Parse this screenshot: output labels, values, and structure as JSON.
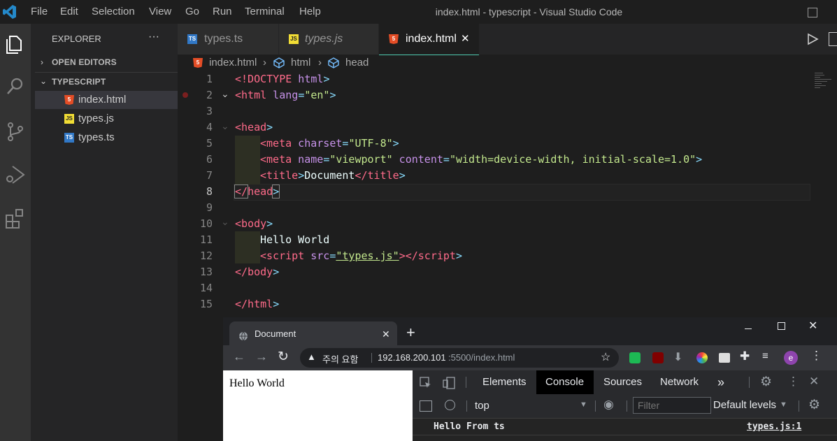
{
  "window": {
    "title": "index.html - typescript - Visual Studio Code"
  },
  "menu": [
    "File",
    "Edit",
    "Selection",
    "View",
    "Go",
    "Run",
    "Terminal",
    "Help"
  ],
  "sidebar": {
    "title": "EXPLORER",
    "more": "···",
    "open_editors": "OPEN EDITORS",
    "folder": "TYPESCRIPT",
    "files": [
      {
        "name": "index.html",
        "icon": "html-file-icon"
      },
      {
        "name": "types.js",
        "icon": "js-file-icon"
      },
      {
        "name": "types.ts",
        "icon": "ts-file-icon"
      }
    ]
  },
  "tabs": [
    {
      "label": "types.ts"
    },
    {
      "label": "types.js"
    },
    {
      "label": "index.html",
      "close": "✕"
    }
  ],
  "breadcrumb": [
    "index.html",
    "html",
    "head"
  ],
  "editor": {
    "line_numbers": [
      "1",
      "2",
      "3",
      "4",
      "5",
      "6",
      "7",
      "8",
      "9",
      "10",
      "11",
      "12",
      "13",
      "14",
      "15"
    ],
    "lines": {
      "l1a": "<!DOCTYPE",
      "l1b": " html",
      "l1c": ">",
      "l2a": "<html",
      "l2b": " lang",
      "l2c": "=",
      "l2d": "\"en\"",
      "l2e": ">",
      "l4a": "<head",
      "l4b": ">",
      "l5a": "<meta",
      "l5b": " charset",
      "l5c": "=",
      "l5d": "\"UTF-8\"",
      "l5e": ">",
      "l6a": "<meta",
      "l6b": " name",
      "l6c": "=",
      "l6d": "\"viewport\"",
      "l6e": " content",
      "l6f": "=",
      "l6g": "\"width=device-width, initial-scale=1.0\"",
      "l6h": ">",
      "l7a": "<title",
      "l7b": ">",
      "l7c": "Document",
      "l7d": "</title",
      "l7e": ">",
      "l8a": "</",
      "l8b": "head",
      "l8c": ">",
      "l10a": "<body",
      "l10b": ">",
      "l11": "Hello World",
      "l12a": "<script",
      "l12b": " src",
      "l12c": "=",
      "l12d": "\"types.js\"",
      "l12e": "></script",
      "l12f": ">",
      "l13a": "</body",
      "l13b": ">",
      "l15a": "</html",
      "l15b": ">"
    }
  },
  "browser": {
    "tab_title": "Document",
    "tab_close": "✕",
    "new_tab": "+",
    "warning_text": "주의 요함",
    "url_host": "192.168.200.101",
    "url_rest": ":5500/index.html",
    "avatar_letter": "e",
    "page_text": "Hello World",
    "devtools": {
      "tabs": [
        "Elements",
        "Console",
        "Sources",
        "Network"
      ],
      "active_tab": "Console",
      "more": "»",
      "context": "top",
      "filter_placeholder": "Filter",
      "levels": "Default levels",
      "log": {
        "message": "Hello From ts",
        "source": "types.js:1"
      }
    }
  },
  "colors": {
    "accent": "#007acc",
    "ts": "#3178c6",
    "js": "#f1dd35",
    "html": "#e44d26"
  }
}
